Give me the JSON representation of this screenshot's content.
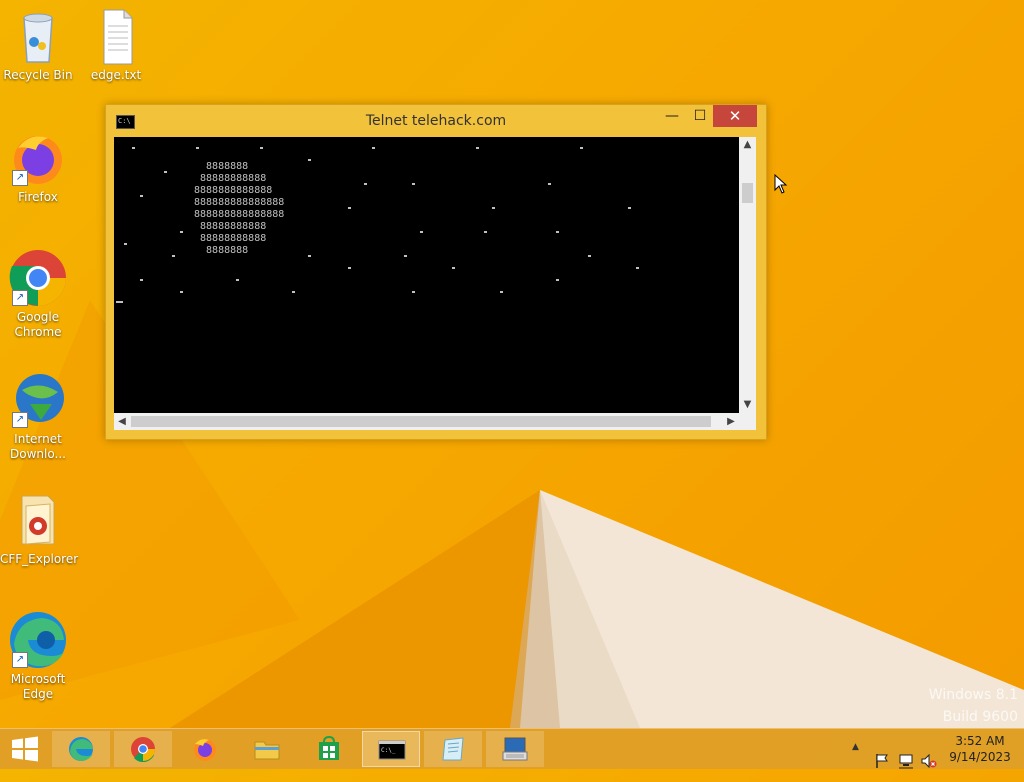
{
  "desktop": {
    "icons": [
      {
        "label": "Recycle Bin",
        "icon": "recycle-bin-icon"
      },
      {
        "label": "edge.txt",
        "icon": "text-file-icon"
      },
      {
        "label": "Firefox",
        "icon": "firefox-icon"
      },
      {
        "label": "Google Chrome",
        "icon": "chrome-icon"
      },
      {
        "label": "Internet Downlo...",
        "icon": "internet-download-manager-icon"
      },
      {
        "label": "CFF_Explorer",
        "icon": "cff-explorer-icon"
      },
      {
        "label": "Microsoft Edge",
        "icon": "edge-icon"
      }
    ]
  },
  "window": {
    "title": "Telnet telehack.com",
    "console_art": "  8888888\n 88888888888\n8888888888888\n888888888888888\n888888888888888\n 88888888888\n 88888888888\n  8888888",
    "minimize_glyph": "—",
    "maximize_glyph": "☐",
    "close_glyph": "✕"
  },
  "watermark": {
    "line1": "Windows 8.1",
    "line2": "Build 9600"
  },
  "taskbar": {
    "items": [
      "start-button",
      "edge",
      "chrome",
      "firefox",
      "file-explorer",
      "store",
      "command-prompt",
      "notepad-like",
      "remote-desktop"
    ],
    "tray": {
      "show_hidden_glyph": "▲",
      "time": "3:52 AM",
      "date": "9/14/2023"
    }
  },
  "colors": {
    "accent": "#f4b400",
    "close": "#c7463c",
    "console_bg": "#000000",
    "console_text": "#c0c0c0"
  }
}
